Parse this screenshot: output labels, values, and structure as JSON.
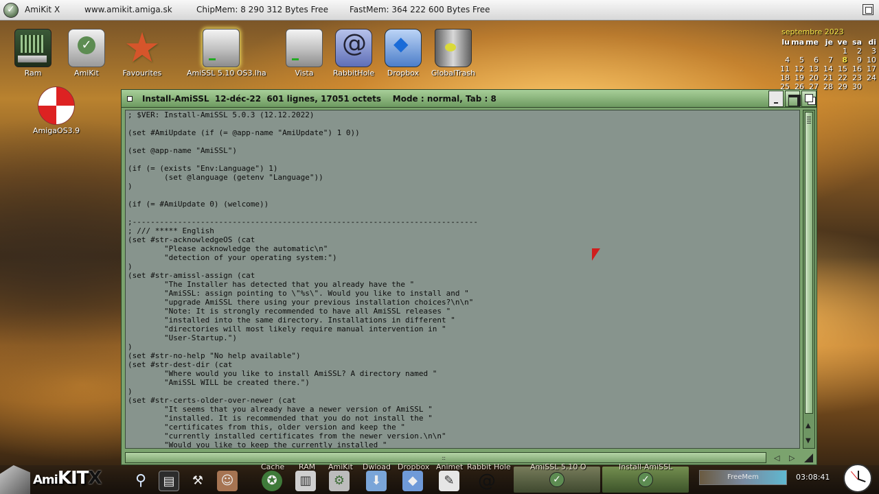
{
  "topbar": {
    "app": "AmiKit X",
    "url": "www.amikit.amiga.sk",
    "chipmem": "ChipMem: 8 290 312 Bytes Free",
    "fastmem": "FastMem: 364 222 600 Bytes Free"
  },
  "desktop": {
    "icons": [
      {
        "label": "Ram",
        "icon": "ram-disk-icon"
      },
      {
        "label": "AmiKit",
        "icon": "amikit-gear-icon"
      },
      {
        "label": "Favourites",
        "icon": "star-icon"
      },
      {
        "label": "AmiSSL 5.10 OS3.lha",
        "icon": "archive-drive-icon"
      },
      {
        "label": "Vista",
        "icon": "drive-icon"
      },
      {
        "label": "RabbitHole",
        "icon": "swirl-icon"
      },
      {
        "label": "Dropbox",
        "icon": "dropbox-icon"
      },
      {
        "label": "GlobalTrash",
        "icon": "trash-icon"
      },
      {
        "label": "AmigaOS3.9",
        "icon": "boing-ball-icon"
      }
    ]
  },
  "calendar": {
    "month": "septembre 2023",
    "days": [
      "lu",
      "ma",
      "me",
      "je",
      "ve",
      "sa",
      "di"
    ],
    "weeks": [
      [
        "",
        "",
        "",
        "",
        "1",
        "2",
        "3"
      ],
      [
        "4",
        "5",
        "6",
        "7",
        "8",
        "9",
        "10"
      ],
      [
        "11",
        "12",
        "13",
        "14",
        "15",
        "16",
        "17"
      ],
      [
        "18",
        "19",
        "20",
        "21",
        "22",
        "23",
        "24"
      ],
      [
        "25",
        "26",
        "27",
        "28",
        "29",
        "30",
        ""
      ]
    ],
    "today": "8"
  },
  "window": {
    "title": "Install-AmiSSL  12-déc-22  601 lignes, 17051 octets    Mode : normal, Tab : 8",
    "content": "; $VER: Install-AmiSSL 5.0.3 (12.12.2022)\n\n(set #AmiUpdate (if (= @app-name \"AmiUpdate\") 1 0))\n\n(set @app-name \"AmiSSL\")\n\n(if (= (exists \"Env:Language\") 1)\n        (set @language (getenv \"Language\"))\n)\n\n(if (= #AmiUpdate 0) (welcome))\n\n;----------------------------------------------------------------------------\n; /// ***** English\n(set #str-acknowledgeOS (cat\n        \"Please acknowledge the automatic\\n\"\n        \"detection of your operating system:\")\n)\n(set #str-amissl-assign (cat\n        \"The Installer has detected that you already have the \"\n        \"AmiSSL: assign pointing to \\\"%s\\\". Would you like to install and \"\n        \"upgrade AmiSSL there using your previous installation choices?\\n\\n\"\n        \"Note: It is strongly recommended to have all AmiSSL releases \"\n        \"installed into the same directory. Installations in different \"\n        \"directories will most likely require manual intervention in \"\n        \"User-Startup.\")\n)\n(set #str-no-help \"No help available\")\n(set #str-dest-dir (cat\n        \"Where would you like to install AmiSSL? A directory named \"\n        \"AmiSSL WILL be created there.\")\n)\n(set #str-certs-older-over-newer (cat\n        \"It seems that you already have a newer version of AmiSSL \"\n        \"installed. It is recommended that you do not install the \"\n        \"certificates from this, older version and keep the \"\n        \"currently installed certificates from the newer version.\\n\\n\"\n        \"Would you like to keep the currently installed \""
  },
  "taskbar": {
    "labels": [
      "Cache",
      "RAM",
      "AmiKit",
      "Dwload",
      "Dropbox",
      "Animet",
      "Rabbit Hole"
    ],
    "tasks": [
      {
        "label": "AmiSSL 5.10 O"
      },
      {
        "label": "Install-AmiSSL"
      }
    ],
    "freemem": "FreeMem",
    "clock": "03:08:41"
  }
}
